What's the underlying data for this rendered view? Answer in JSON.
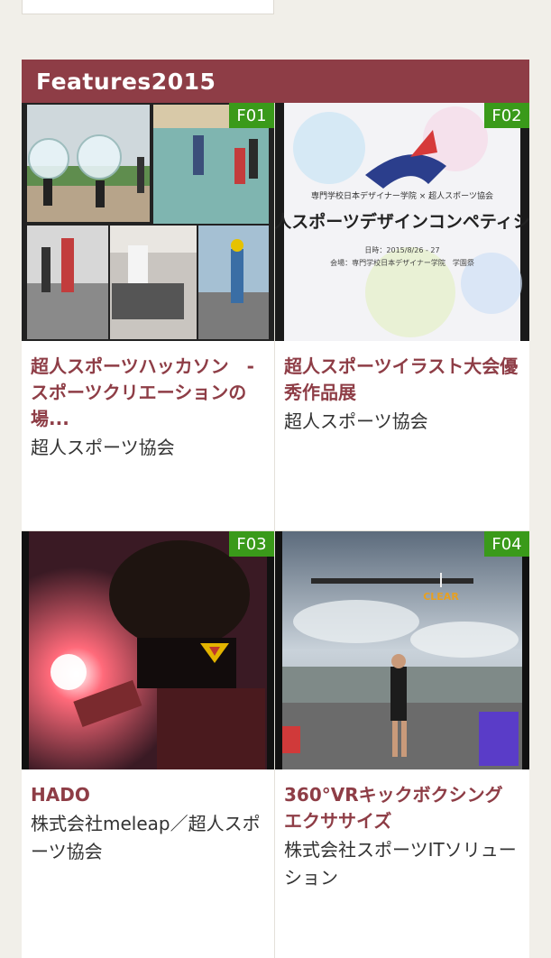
{
  "section": {
    "title": "Features2015"
  },
  "cards": [
    {
      "badge": "F01",
      "title": "超人スポーツハッカソン　-スポーツクリエーションの場...",
      "subtitle": "超人スポーツ協会"
    },
    {
      "badge": "F02",
      "title": "超人スポーツイラスト大会優秀作品展",
      "subtitle": "超人スポーツ協会",
      "poster": {
        "line1": "専門学校日本デザイナー学院 × 超人スポーツ協会",
        "headline": "超人スポーツデザインコンペティショ",
        "line2": "日時：2015/8/26 - 27",
        "line3": "会場：専門学校日本デザイナー学院　学園祭"
      }
    },
    {
      "badge": "F03",
      "title": "HADO",
      "subtitle": "株式会社meleap／超人スポーツ協会"
    },
    {
      "badge": "F04",
      "title": "360°VRキックボクシングエクササイズ",
      "subtitle": "株式会社スポーツITソリューション",
      "hud_text": "CLEAR"
    }
  ],
  "colors": {
    "header_bg": "#8e3d46",
    "title_text": "#8e3d46",
    "badge_bg": "#3a9a1a",
    "page_bg": "#f1efe9"
  }
}
